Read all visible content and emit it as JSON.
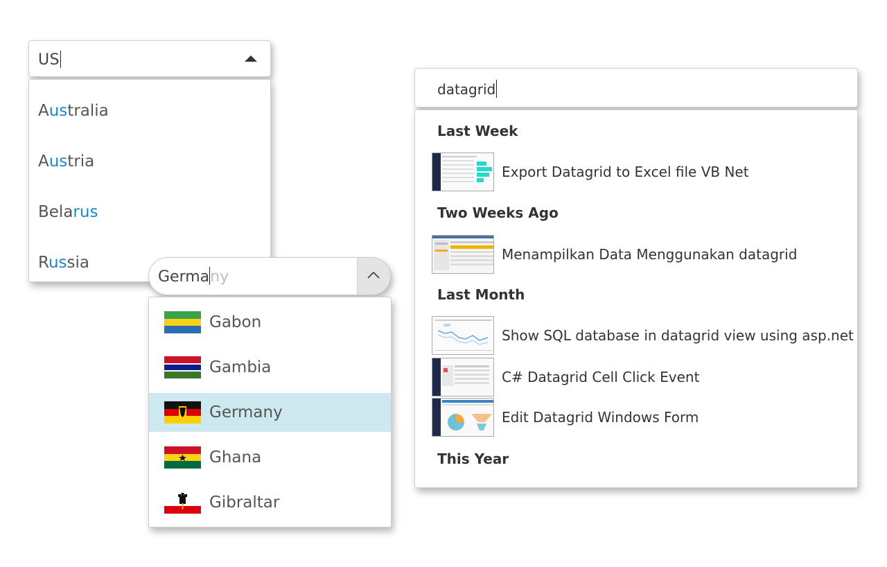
{
  "combo1": {
    "input_value": "US",
    "items": [
      {
        "pre": "A",
        "match": "us",
        "post": "tralia"
      },
      {
        "pre": "A",
        "match": "us",
        "post": "tria"
      },
      {
        "pre": "Bela",
        "match": "rus",
        "post": ""
      },
      {
        "pre": "R",
        "match": "us",
        "post": "sia"
      }
    ]
  },
  "combo2": {
    "typed": "Germa",
    "suggestion": "ny",
    "items": [
      {
        "label": "Gabon",
        "flag": "gabon-flag-icon",
        "selected": false
      },
      {
        "label": "Gambia",
        "flag": "gambia-flag-icon",
        "selected": false
      },
      {
        "label": "Germany",
        "flag": "germany-flag-icon",
        "selected": true
      },
      {
        "label": "Ghana",
        "flag": "ghana-flag-icon",
        "selected": false
      },
      {
        "label": "Gibraltar",
        "flag": "gibraltar-flag-icon",
        "selected": false
      }
    ]
  },
  "search": {
    "input_value": "datagrid",
    "groups": [
      {
        "title": "Last Week",
        "items": [
          {
            "label": "Export Datagrid to Excel file VB Net"
          }
        ]
      },
      {
        "title": "Two Weeks Ago",
        "items": [
          {
            "label": "Menampilkan Data Menggunakan datagrid"
          }
        ]
      },
      {
        "title": "Last Month",
        "items": [
          {
            "label": "Show SQL database in datagrid view using asp.net"
          },
          {
            "label": "C# Datagrid Cell Click Event"
          },
          {
            "label": "Edit Datagrid Windows Form"
          }
        ]
      },
      {
        "title": "This Year",
        "items": []
      }
    ]
  },
  "colors": {
    "highlight": "#1a87c9",
    "selected_bg": "#cde9ef",
    "ghost_text": "#bdbdbd"
  }
}
